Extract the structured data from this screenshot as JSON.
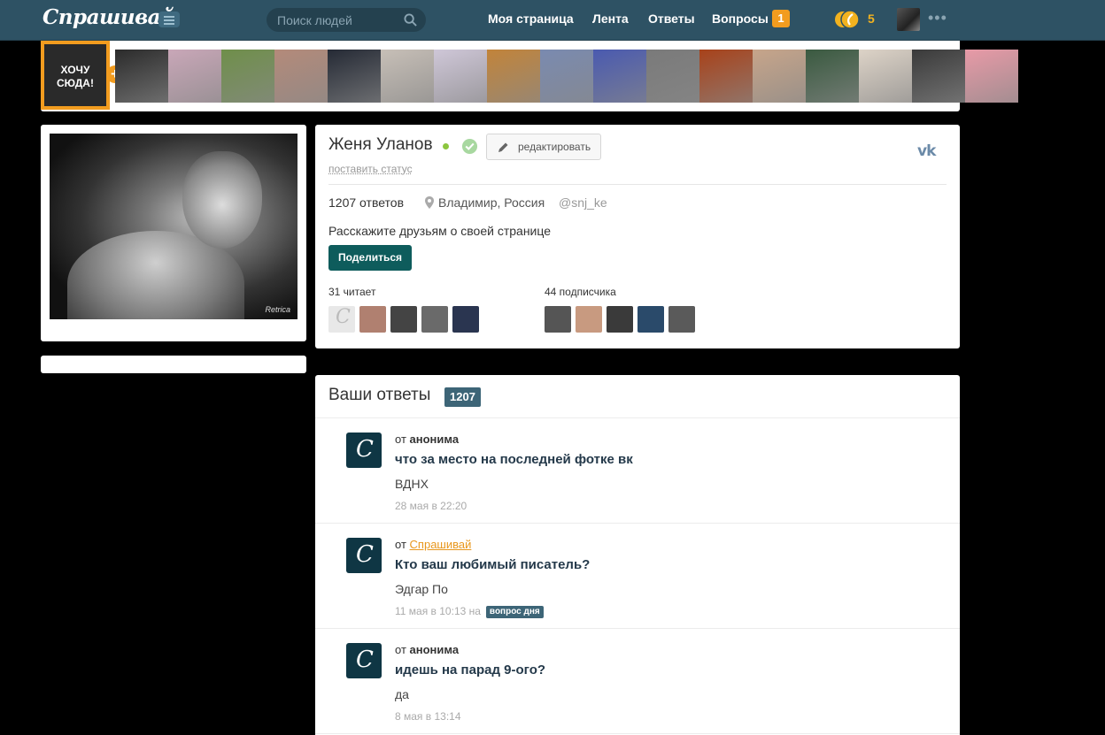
{
  "header": {
    "logo": "Спрашивай",
    "search_placeholder": "Поиск людей",
    "nav": [
      "Моя страница",
      "Лента",
      "Ответы",
      "Вопросы"
    ],
    "questions_badge": "1",
    "coins": "5",
    "more": "•••"
  },
  "strip": {
    "want_label": "ХОЧУ СЮДА!",
    "plus": "+",
    "thumb_colors": [
      "#2b2b2b",
      "#c9a7b8",
      "#6f8f4a",
      "#b48a7a",
      "#252a35",
      "#c7bfb7",
      "#cfc7d8",
      "#c2843a",
      "#7a8ab0",
      "#4a5ab0",
      "#7a7a7a",
      "#a8421a",
      "#c7a58a",
      "#3a5a40",
      "#ddd3c7",
      "#3a3a3a",
      "#e89aa7"
    ]
  },
  "profile": {
    "name": "Женя Уланов",
    "edit_label": "редактировать",
    "status_link": "поставить статус",
    "vk": "vk",
    "answers_count": "1207",
    "answers_word": "ответов",
    "location": "Владимир, Россия",
    "handle": "@snj_ke",
    "share_text": "Расскажите друзьям о своей странице",
    "share_button": "Поделиться",
    "reading_label": "31 читает",
    "followers_label": "44 подписчика",
    "photo_signature": "Retrica"
  },
  "answers": {
    "title": "Ваши ответы",
    "count": "1207",
    "items": [
      {
        "from_prefix": "от",
        "from": "анонима",
        "question": "что за место на последней фотке вк",
        "answer": "ВДНХ",
        "date": "28 мая в 22:20"
      },
      {
        "from_prefix": "от",
        "from": "Спрашивай",
        "question": "Кто ваш любимый писатель?",
        "answer": "Эдгар По",
        "date": "11 мая в 10:13 на",
        "tag": "вопрос дня"
      },
      {
        "from_prefix": "от",
        "from": "анонима",
        "question": "идешь на парад 9-ого?",
        "answer": "да",
        "date": "8 мая в 13:14"
      }
    ]
  }
}
